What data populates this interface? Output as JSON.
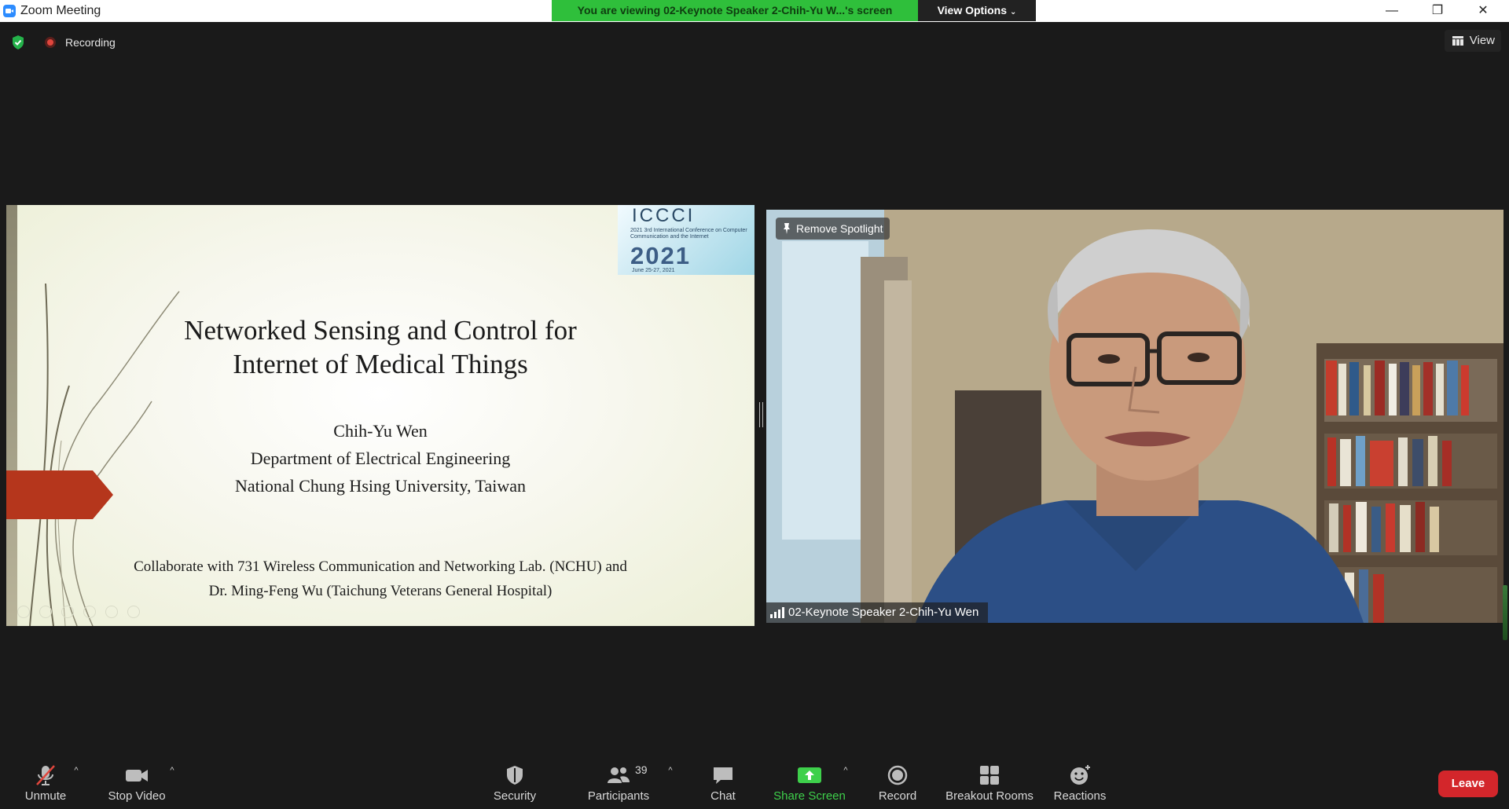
{
  "window": {
    "title": "Zoom Meeting"
  },
  "banner": {
    "viewing_text": "You are viewing 02-Keynote Speaker 2-Chih-Yu W...'s screen",
    "view_options_label": "View Options"
  },
  "status": {
    "recording_label": "Recording",
    "view_label": "View"
  },
  "slide": {
    "logo": {
      "name": "ICCCI",
      "subtitle": "2021 3rd International Conference on Computer Communication and the Internet",
      "year": "2021",
      "dates": "June 25-27, 2021"
    },
    "title_line1": "Networked Sensing and Control for",
    "title_line2": "Internet of Medical Things",
    "author": "Chih-Yu Wen",
    "department": "Department of Electrical Engineering",
    "university": "National Chung Hsing University, Taiwan",
    "collab_line1": "Collaborate with 731 Wireless Communication and Networking Lab. (NCHU) and",
    "collab_line2": "Dr. Ming-Feng Wu (Taichung Veterans General Hospital)"
  },
  "video": {
    "spotlight_label": "Remove Spotlight",
    "participant_name": "02-Keynote Speaker 2-Chih-Yu Wen"
  },
  "toolbar": {
    "unmute": "Unmute",
    "stop_video": "Stop Video",
    "security": "Security",
    "participants": "Participants",
    "participant_count": "39",
    "chat": "Chat",
    "share_screen": "Share Screen",
    "record": "Record",
    "breakout_rooms": "Breakout Rooms",
    "reactions": "Reactions",
    "leave": "Leave"
  },
  "colors": {
    "share_green": "#3ed04b",
    "leave_red": "#d3262b",
    "banner_green": "#2fbf3b",
    "slide_arrow": "#b5361c"
  }
}
